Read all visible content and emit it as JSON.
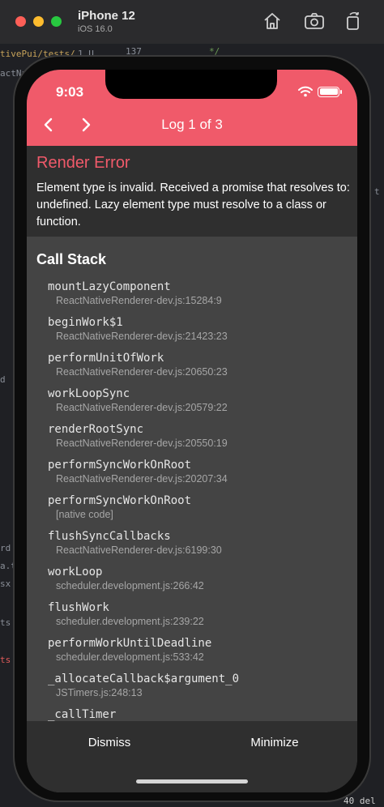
{
  "simulator": {
    "device_name": "iPhone 12",
    "os_version": "iOS 16.0",
    "icons": [
      "home-icon",
      "screenshot-icon",
      "rotate-icon"
    ]
  },
  "editor_bleed": {
    "line_num": "137",
    "line_num2": "1 U",
    "frag_1": "tivePui/tests/",
    "frag_2": "*/",
    "frag_3": "actNa",
    "frag_4": "d",
    "frag_5": "rd",
    "frag_6": "t",
    "frag_7": "sx",
    "frag_8": "ts",
    "frag_9": "a.t",
    "frag_10": "ts",
    "frag_11": "40 del"
  },
  "status_bar": {
    "time": "9:03"
  },
  "header": {
    "title": "Log 1 of 3",
    "color": "#f05a6a"
  },
  "error": {
    "title": "Render Error",
    "message": "Element type is invalid. Received a promise that resolves to: undefined. Lazy element type must resolve to a class or function."
  },
  "call_stack": {
    "title": "Call Stack",
    "frames": [
      {
        "fn": "mountLazyComponent",
        "file": "ReactNativeRenderer-dev.js:15284:9"
      },
      {
        "fn": "beginWork$1",
        "file": "ReactNativeRenderer-dev.js:21423:23"
      },
      {
        "fn": "performUnitOfWork",
        "file": "ReactNativeRenderer-dev.js:20650:23"
      },
      {
        "fn": "workLoopSync",
        "file": "ReactNativeRenderer-dev.js:20579:22"
      },
      {
        "fn": "renderRootSync",
        "file": "ReactNativeRenderer-dev.js:20550:19"
      },
      {
        "fn": "performSyncWorkOnRoot",
        "file": "ReactNativeRenderer-dev.js:20207:34"
      },
      {
        "fn": "performSyncWorkOnRoot",
        "file": "[native code]"
      },
      {
        "fn": "flushSyncCallbacks",
        "file": "ReactNativeRenderer-dev.js:6199:30"
      },
      {
        "fn": "workLoop",
        "file": "scheduler.development.js:266:42"
      },
      {
        "fn": "flushWork",
        "file": "scheduler.development.js:239:22"
      },
      {
        "fn": "performWorkUntilDeadline",
        "file": "scheduler.development.js:533:42"
      },
      {
        "fn": "_allocateCallback$argument_0",
        "file": "JSTimers.js:248:13"
      },
      {
        "fn": "_callTimer",
        "file": ""
      }
    ]
  },
  "footer": {
    "dismiss_label": "Dismiss",
    "minimize_label": "Minimize"
  }
}
